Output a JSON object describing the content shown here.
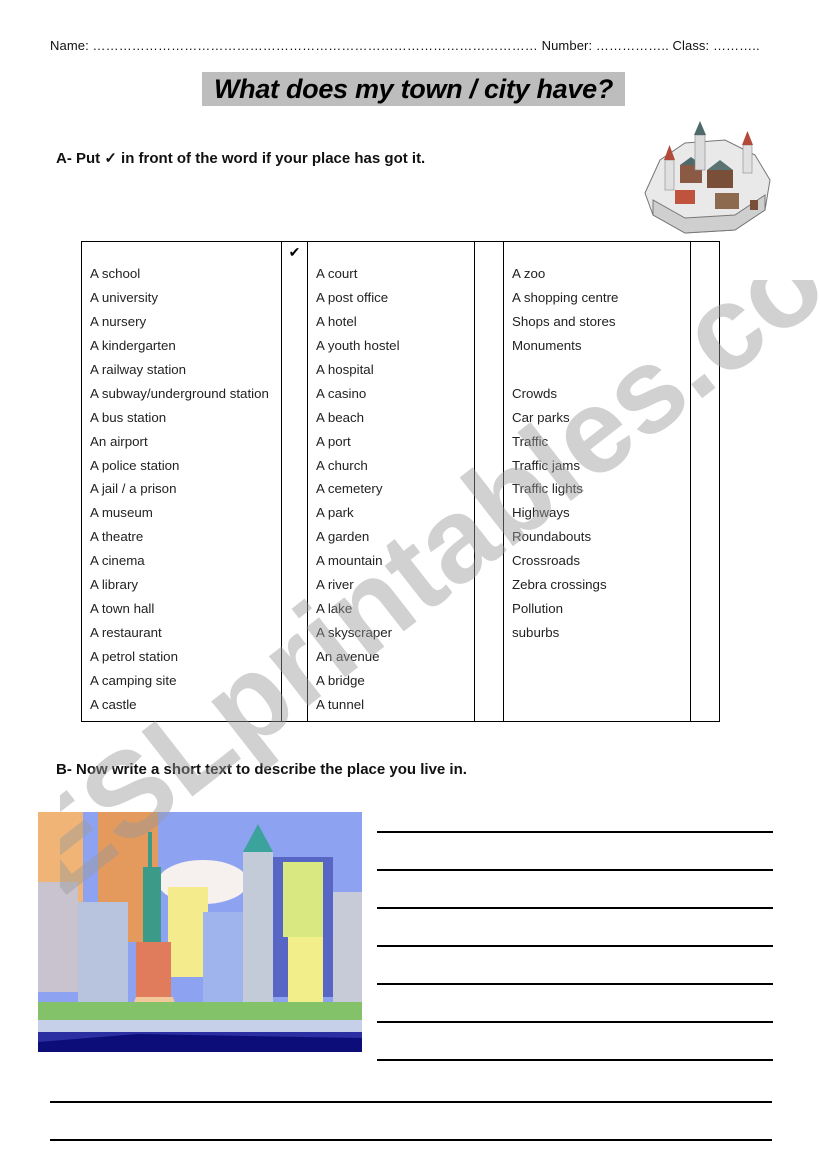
{
  "header": {
    "name_line": "Name: ………………………………………………………………………………………… Number: …………….. Class: ………..",
    "title": "What does my town / city have?"
  },
  "section_a": {
    "instruction": "A-  Put ✓ in front of the word if your place has got it."
  },
  "table": {
    "column1": [
      "A school",
      "A university",
      "A nursery",
      "A kindergarten",
      "A railway station",
      "A subway/underground  station",
      "A bus station",
      "An airport",
      "A police station",
      "A jail / a prison",
      "A museum",
      "A theatre",
      "A cinema",
      "A library",
      "A town hall",
      "A restaurant",
      "A petrol station",
      "A camping site",
      "A castle"
    ],
    "column1_checks": [
      "✔"
    ],
    "column2": [
      "A court",
      "A post office",
      "A hotel",
      "A youth hostel",
      "A hospital",
      "A casino",
      "A beach",
      "A port",
      "A church",
      "A cemetery",
      "A park",
      "A garden",
      "A mountain",
      "A river",
      "A lake",
      "A skyscraper",
      "An avenue",
      "A bridge",
      "A tunnel"
    ],
    "column3": [
      "A zoo",
      "A shopping centre",
      "Shops and stores",
      "Monuments",
      "",
      "Crowds",
      "Car parks",
      "Traffic",
      "Traffic jams",
      "Traffic lights",
      "Highways",
      "Roundabouts",
      "Crossroads",
      "Zebra crossings",
      "Pollution",
      "suburbs"
    ]
  },
  "section_b": {
    "instruction": "B-  Now write a short text to describe the place you live in."
  },
  "images": {
    "castle": "walled-town-illustration",
    "city": "city-skyline-statue-of-liberty-illustration"
  },
  "watermark": "ESLprintables.com"
}
